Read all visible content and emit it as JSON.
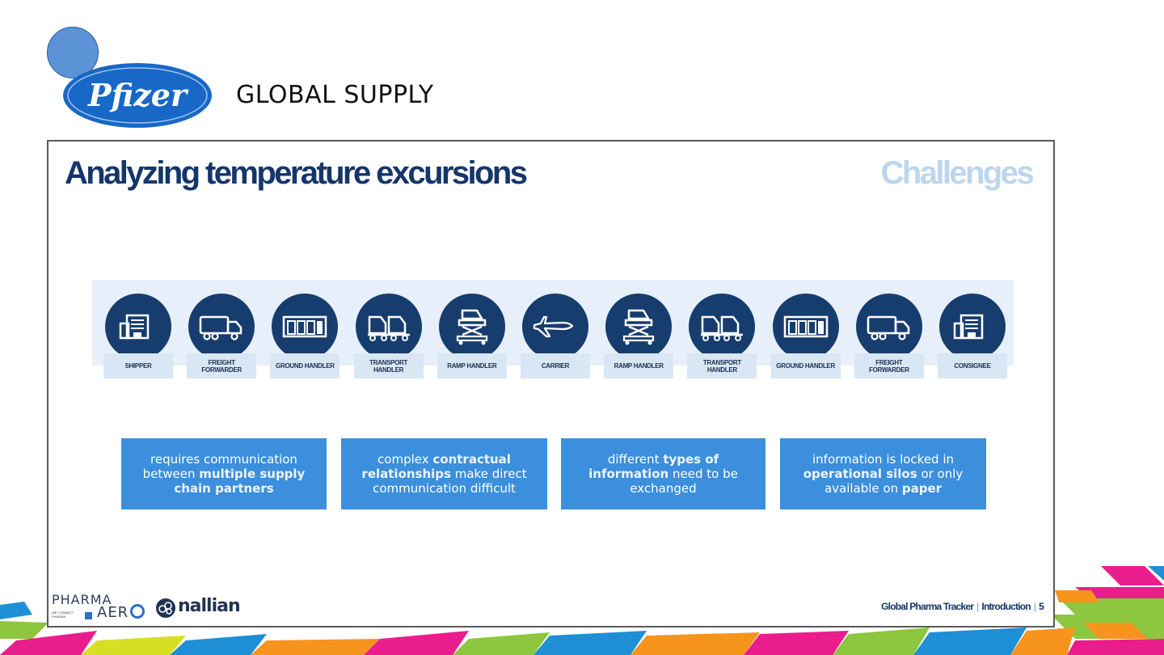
{
  "header": {
    "brand": "Pfizer",
    "subtitle": "GLOBAL SUPPLY"
  },
  "slide": {
    "title": "Analyzing temperature excursions",
    "section": "Challenges",
    "chain": [
      {
        "label": "SHIPPER",
        "icon": "warehouse-icon"
      },
      {
        "label": "FREIGHT FORWARDER",
        "icon": "truck-icon"
      },
      {
        "label": "GROUND HANDLER",
        "icon": "warehouse-doors-icon"
      },
      {
        "label": "TRANSPORT HANDLER",
        "icon": "cargo-dolly-icon"
      },
      {
        "label": "RAMP HANDLER",
        "icon": "loader-icon"
      },
      {
        "label": "CARRIER",
        "icon": "airplane-icon"
      },
      {
        "label": "RAMP HANDLER",
        "icon": "loader-icon"
      },
      {
        "label": "TRANSPORT HANDLER",
        "icon": "cargo-dolly-icon"
      },
      {
        "label": "GROUND HANDLER",
        "icon": "warehouse-doors-icon"
      },
      {
        "label": "FREIGHT FORWARDER",
        "icon": "truck-icon"
      },
      {
        "label": "CONSIGNEE",
        "icon": "warehouse-icon"
      }
    ],
    "challenges": [
      {
        "parts": [
          "requires communication between ",
          "multiple supply chain partners",
          ""
        ]
      },
      {
        "parts": [
          "complex ",
          "contractual relationships",
          " make direct communication difficult"
        ]
      },
      {
        "parts": [
          "different ",
          "types of information",
          " need to be exchanged"
        ]
      },
      {
        "parts": [
          "information is locked in ",
          "operational silos",
          " or only available on ",
          "paper"
        ]
      }
    ],
    "footer": {
      "pharma": "PHARMA",
      "aero": "AER",
      "tagline": "WE CONNECT PHARMA",
      "partner": "nallian",
      "doc": "Global Pharma Tracker",
      "chapter": "Introduction",
      "page": "5"
    }
  },
  "colors": {
    "navy": "#14366a",
    "accent_blue": "#3b8fdc",
    "light_band": "#e7f0fa",
    "section_light": "#bcd6ee"
  }
}
